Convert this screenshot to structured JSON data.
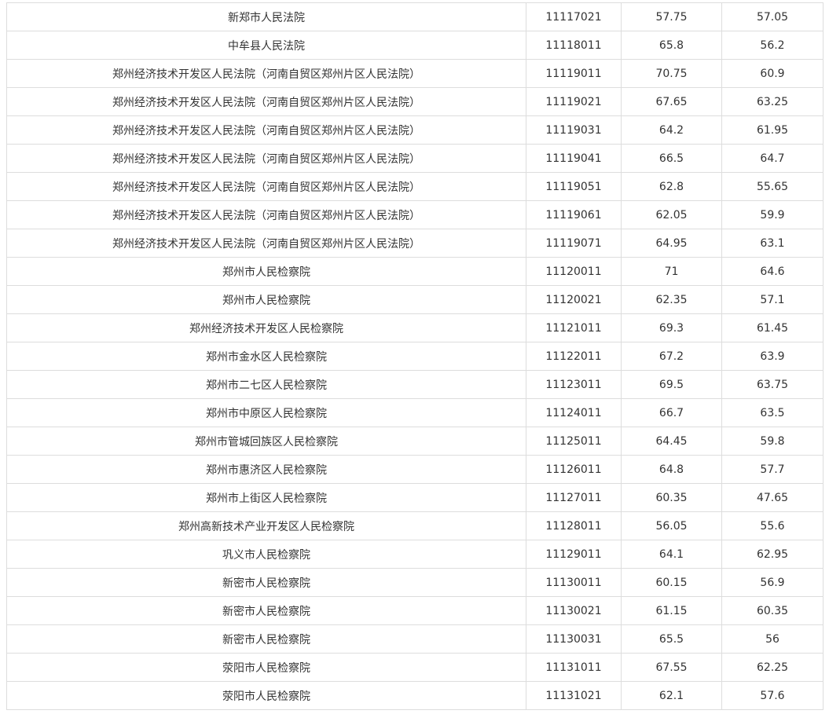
{
  "table": {
    "rows": [
      [
        "新郑市人民法院",
        "11117021",
        "57.75",
        "57.05"
      ],
      [
        "中牟县人民法院",
        "11118011",
        "65.8",
        "56.2"
      ],
      [
        "郑州经济技术开发区人民法院（河南自贸区郑州片区人民法院）",
        "11119011",
        "70.75",
        "60.9"
      ],
      [
        "郑州经济技术开发区人民法院（河南自贸区郑州片区人民法院）",
        "11119021",
        "67.65",
        "63.25"
      ],
      [
        "郑州经济技术开发区人民法院（河南自贸区郑州片区人民法院）",
        "11119031",
        "64.2",
        "61.95"
      ],
      [
        "郑州经济技术开发区人民法院（河南自贸区郑州片区人民法院）",
        "11119041",
        "66.5",
        "64.7"
      ],
      [
        "郑州经济技术开发区人民法院（河南自贸区郑州片区人民法院）",
        "11119051",
        "62.8",
        "55.65"
      ],
      [
        "郑州经济技术开发区人民法院（河南自贸区郑州片区人民法院）",
        "11119061",
        "62.05",
        "59.9"
      ],
      [
        "郑州经济技术开发区人民法院（河南自贸区郑州片区人民法院）",
        "11119071",
        "64.95",
        "63.1"
      ],
      [
        "郑州市人民检察院",
        "11120011",
        "71",
        "64.6"
      ],
      [
        "郑州市人民检察院",
        "11120021",
        "62.35",
        "57.1"
      ],
      [
        "郑州经济技术开发区人民检察院",
        "11121011",
        "69.3",
        "61.45"
      ],
      [
        "郑州市金水区人民检察院",
        "11122011",
        "67.2",
        "63.9"
      ],
      [
        "郑州市二七区人民检察院",
        "11123011",
        "69.5",
        "63.75"
      ],
      [
        "郑州市中原区人民检察院",
        "11124011",
        "66.7",
        "63.5"
      ],
      [
        "郑州市管城回族区人民检察院",
        "11125011",
        "64.45",
        "59.8"
      ],
      [
        "郑州市惠济区人民检察院",
        "11126011",
        "64.8",
        "57.7"
      ],
      [
        "郑州市上街区人民检察院",
        "11127011",
        "60.35",
        "47.65"
      ],
      [
        "郑州高新技术产业开发区人民检察院",
        "11128011",
        "56.05",
        "55.6"
      ],
      [
        "巩义市人民检察院",
        "11129011",
        "64.1",
        "62.95"
      ],
      [
        "新密市人民检察院",
        "11130011",
        "60.15",
        "56.9"
      ],
      [
        "新密市人民检察院",
        "11130021",
        "61.15",
        "60.35"
      ],
      [
        "新密市人民检察院",
        "11130031",
        "65.5",
        "56"
      ],
      [
        "荥阳市人民检察院",
        "11131011",
        "67.55",
        "62.25"
      ],
      [
        "荥阳市人民检察院",
        "11131021",
        "62.1",
        "57.6"
      ]
    ]
  }
}
